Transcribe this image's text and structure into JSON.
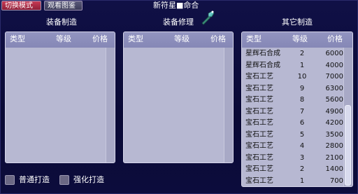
{
  "toolbar": {
    "switch_mode_label": "切换模式",
    "view_catalog_label": "观看图鉴"
  },
  "window_title": "新符星■命合",
  "sections": {
    "equipment_craft": {
      "title": "装备制造",
      "headers": [
        "类型",
        "等级",
        "价格"
      ]
    },
    "equipment_repair": {
      "title": "装备修理",
      "headers": [
        "类型",
        "等级",
        "价格"
      ]
    },
    "other_craft": {
      "title": "其它制造",
      "headers": [
        "类型",
        "等级",
        "价格"
      ],
      "rows": [
        {
          "type": "星辉石合成",
          "level": "2",
          "price": "6000"
        },
        {
          "type": "星辉石合成",
          "level": "1",
          "price": "4000"
        },
        {
          "type": "宝石工艺",
          "level": "10",
          "price": "7000"
        },
        {
          "type": "宝石工艺",
          "level": "9",
          "price": "6300"
        },
        {
          "type": "宝石工艺",
          "level": "8",
          "price": "5600"
        },
        {
          "type": "宝石工艺",
          "level": "7",
          "price": "4900"
        },
        {
          "type": "宝石工艺",
          "level": "6",
          "price": "4200"
        },
        {
          "type": "宝石工艺",
          "level": "5",
          "price": "3500"
        },
        {
          "type": "宝石工艺",
          "level": "4",
          "price": "2800"
        },
        {
          "type": "宝石工艺",
          "level": "3",
          "price": "2100"
        },
        {
          "type": "宝石工艺",
          "level": "2",
          "price": "1400"
        },
        {
          "type": "宝石工艺",
          "level": "1",
          "price": "700"
        }
      ]
    }
  },
  "options": {
    "normal_forge_label": "普通打造",
    "enhanced_forge_label": "强化打造"
  },
  "icons": {
    "repair_tool": "magic-wand-icon"
  }
}
